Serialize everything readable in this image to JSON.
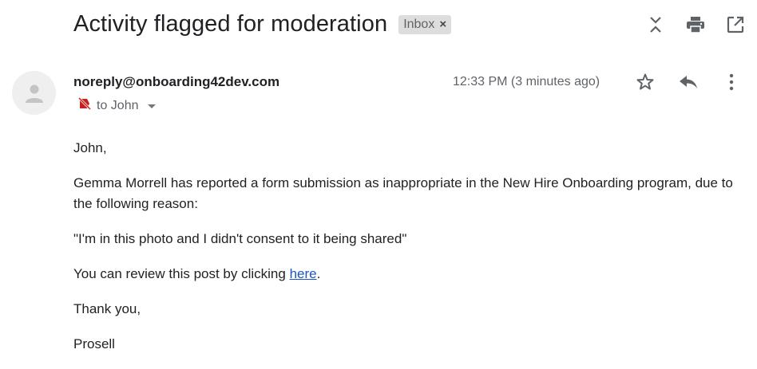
{
  "header": {
    "subject": "Activity flagged for moderation",
    "label_chip": "Inbox",
    "chip_close": "×"
  },
  "toolbar": {
    "icons": [
      "expand-collapse-icon",
      "print-icon",
      "open-in-new-window-icon"
    ]
  },
  "message": {
    "sender": "noreply@onboarding42dev.com",
    "recipient": "to John",
    "timestamp": "12:33 PM (3 minutes ago)",
    "actions": [
      "star-icon",
      "reply-icon",
      "more-vert-icon"
    ],
    "body": {
      "greeting": "John,",
      "paragraph1": "Gemma Morrell has reported a form submission as inappropriate in the New Hire Onboarding program, due to the following reason:",
      "quote": "\"I'm in this photo and I didn't consent to it being shared\"",
      "review_prefix": "You can review this post by clicking ",
      "review_link": "here",
      "review_suffix": ".",
      "closing": "Thank you,",
      "signature": "Prosell"
    }
  },
  "colors": {
    "link": "#1a56c4",
    "chip_bg": "#dddddd",
    "not_important_marker": "#c5221f"
  }
}
